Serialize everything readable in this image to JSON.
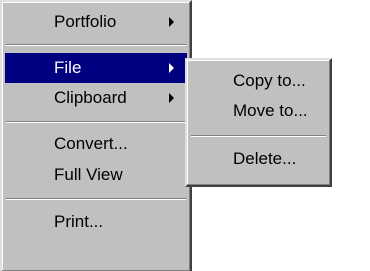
{
  "main_menu": {
    "items": [
      {
        "label": "Portfolio",
        "has_submenu": true
      },
      {
        "label": "File",
        "has_submenu": true,
        "selected": true
      },
      {
        "label": "Clipboard",
        "has_submenu": true
      },
      {
        "label": "Convert..."
      },
      {
        "label": "Full View"
      },
      {
        "label": "Print..."
      }
    ]
  },
  "file_submenu": {
    "items": [
      {
        "label": "Copy to..."
      },
      {
        "label": "Move to..."
      },
      {
        "label": "Delete..."
      }
    ]
  },
  "colors": {
    "menu_background": "#c0c0c0",
    "highlight": "#000080",
    "highlight_text": "#ffffff",
    "text": "#000000"
  },
  "icons": {
    "submenu_arrow": "triangle-right-icon"
  }
}
